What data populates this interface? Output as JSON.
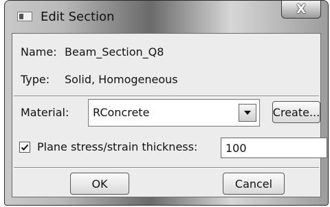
{
  "window": {
    "title": "Edit Section",
    "close_glyph": "X"
  },
  "section": {
    "name_label": "Name:",
    "name_value": "Beam_Section_Q8",
    "type_label": "Type:",
    "type_value": "Solid, Homogeneous"
  },
  "material": {
    "label": "Material:",
    "selected": "RConcrete",
    "create_button": "Create..."
  },
  "thickness": {
    "checkbox_checked": true,
    "label": "Plane stress/strain thickness:",
    "value": "100"
  },
  "footer": {
    "ok_label": "OK",
    "cancel_label": "Cancel"
  },
  "icons": {
    "app": "window-icon",
    "close": "close-icon",
    "dropdown": "chevron-down-icon",
    "check": "check-icon"
  }
}
